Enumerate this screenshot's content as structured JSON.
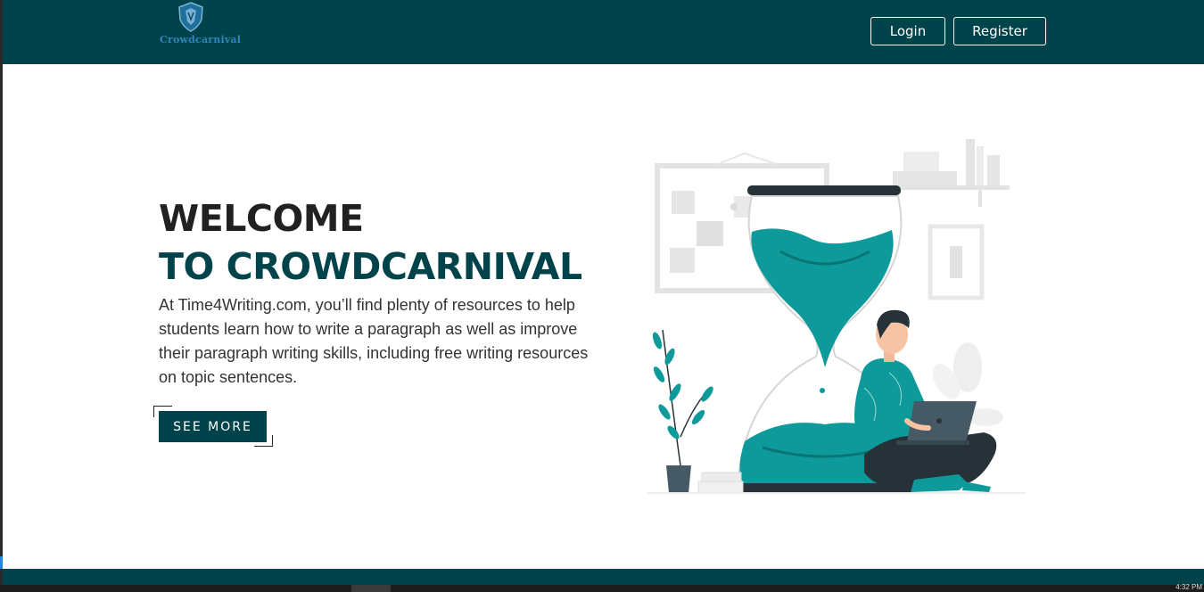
{
  "brand": {
    "name": "Crowdcarnival"
  },
  "nav": {
    "login_label": "Login",
    "register_label": "Register"
  },
  "hero": {
    "title_line1": "WELCOME",
    "title_line2": "TO CROWDCARNIVAL",
    "description": "At Time4Writing.com, you’ll find plenty of resources to help students learn how to write a paragraph as well as improve their paragraph writing skills, including free writing resources on topic sentences.",
    "cta_label": "SEE MORE"
  },
  "taskbar": {
    "clock": "4:32 PM"
  },
  "colors": {
    "primary": "#01434a",
    "accent_teal": "#0e9a9a",
    "text_dark": "#212121",
    "logo_blue": "#2f86b8"
  }
}
